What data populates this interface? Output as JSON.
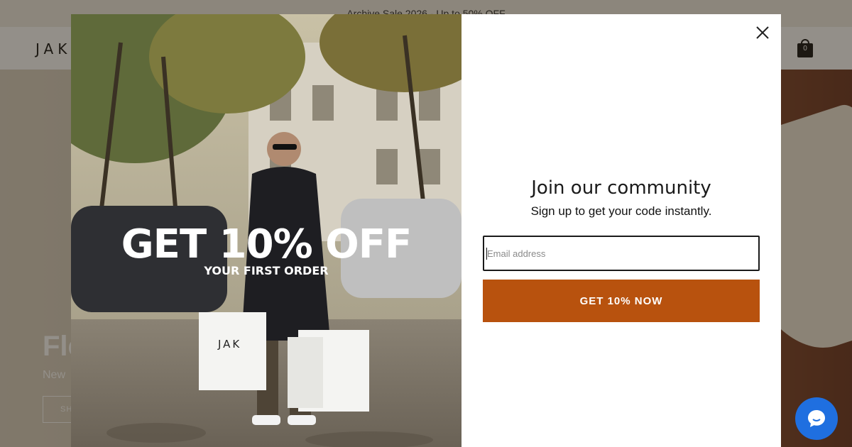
{
  "announcement": "Archive Sale 2026 - Up to 50% OFF",
  "header": {
    "logo": "JAK",
    "cart_count": "0"
  },
  "hero": {
    "title": "Fle",
    "subtitle": "New",
    "button": "SH"
  },
  "modal": {
    "promo_headline": "GET 10% OFF",
    "promo_sub": "YOUR FIRST ORDER",
    "bag_brand": "JAK",
    "title": "Join our community",
    "subtitle": "Sign up to get your code instantly.",
    "email_placeholder": "Email address",
    "email_value": "",
    "cta_label": "GET 10% NOW"
  },
  "colors": {
    "cta": "#b8520e",
    "chat": "#1f6fe0"
  },
  "icons": {
    "close": "close-icon",
    "cart": "shopping-bag-icon",
    "chat": "chat-bubble-icon"
  }
}
